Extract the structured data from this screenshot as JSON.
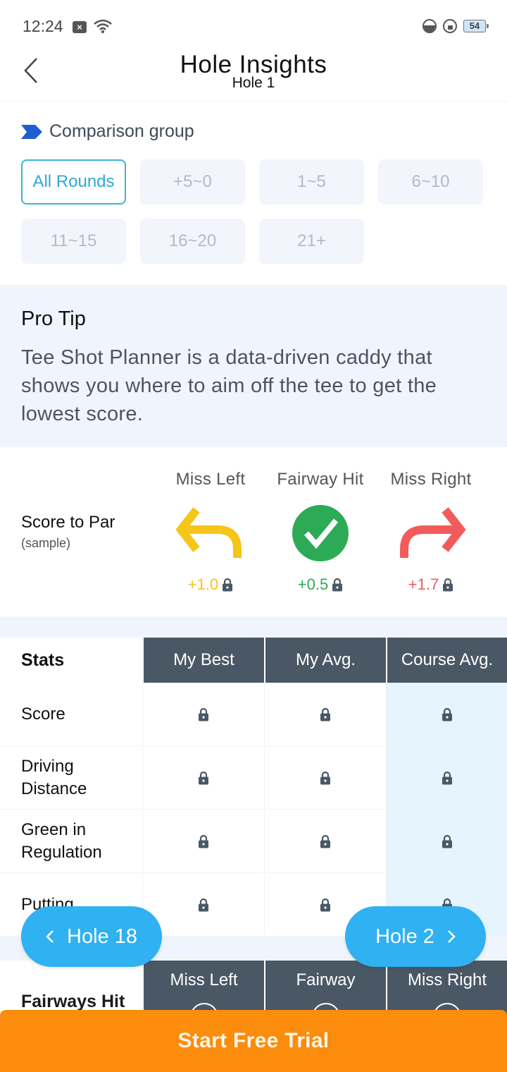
{
  "status_bar": {
    "time": "12:24",
    "battery": "54"
  },
  "header": {
    "title": "Hole Insights",
    "subtitle": "Hole 1"
  },
  "comparison": {
    "title": "Comparison group",
    "chips": [
      {
        "label": "All Rounds",
        "active": true
      },
      {
        "label": "+5~0"
      },
      {
        "label": "1~5"
      },
      {
        "label": "6~10"
      },
      {
        "label": "11~15"
      },
      {
        "label": "16~20"
      },
      {
        "label": "21+"
      }
    ]
  },
  "pro_tip": {
    "title": "Pro Tip",
    "body": "Tee Shot Planner is a data-driven caddy that shows you where to aim off the tee to get the lowest score."
  },
  "score_to_par": {
    "label": "Score to Par",
    "sublabel": "(sample)",
    "columns": [
      {
        "header": "Miss Left",
        "value": "+1.0",
        "color": "#f5c518"
      },
      {
        "header": "Fairway Hit",
        "value": "+0.5",
        "color": "#2daa55"
      },
      {
        "header": "Miss Right",
        "value": "+1.7",
        "color": "#f25b5b"
      }
    ]
  },
  "stats": {
    "headers": [
      "Stats",
      "My Best",
      "My Avg.",
      "Course Avg."
    ],
    "rows": [
      {
        "label": "Score"
      },
      {
        "label": "Driving Distance"
      },
      {
        "label": "Green in Regulation"
      },
      {
        "label": "Putting"
      }
    ]
  },
  "fairways": {
    "label": "Fairways Hit",
    "headers": [
      "Miss Left",
      "Fairway",
      "Miss Right"
    ]
  },
  "nav": {
    "prev": "Hole 18",
    "next": "Hole 2"
  },
  "cta": {
    "label": "Start Free Trial"
  }
}
